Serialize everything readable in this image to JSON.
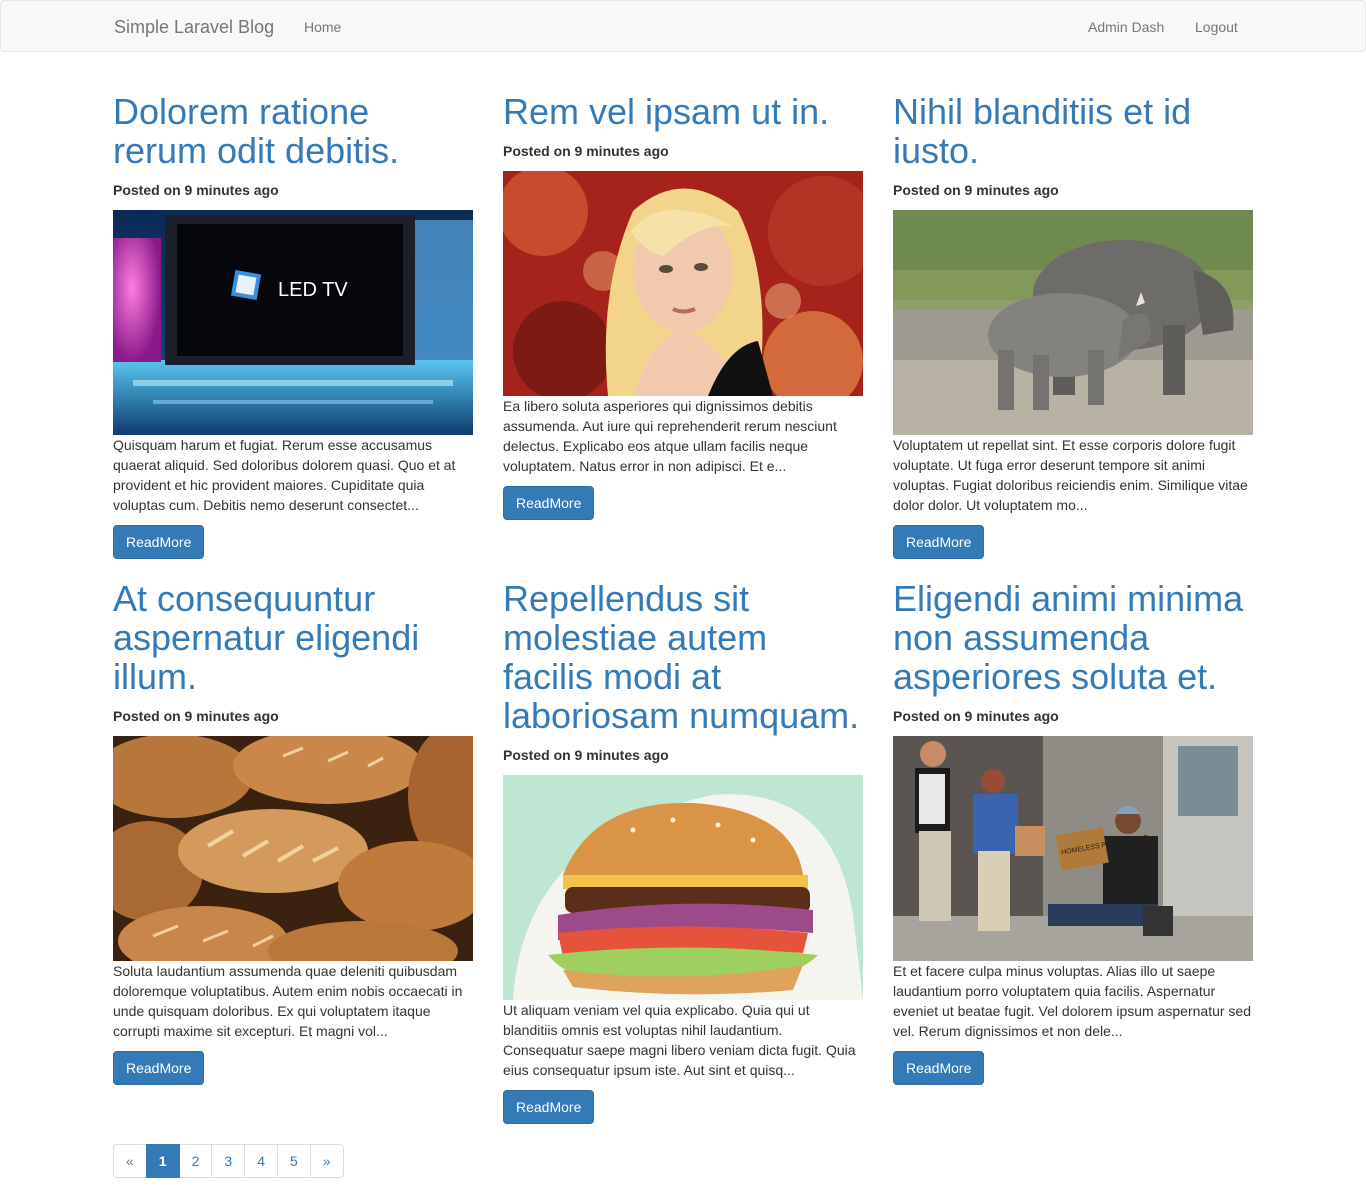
{
  "navbar": {
    "brand": "Simple Laravel Blog",
    "home": "Home",
    "admin": "Admin Dash",
    "logout": "Logout"
  },
  "posts": [
    {
      "title": "Dolorem ratione rerum odit debitis.",
      "meta": "Posted on 9 minutes ago",
      "image": "led-tv-showroom-photo",
      "excerpt": "Quisquam harum et fugiat. Rerum esse accusamus quaerat aliquid. Sed doloribus dolorem quasi. Quo et at provident et hic provident maiores. Cupiditate quia voluptas cum. Debitis nemo deserunt consectet...",
      "button": "ReadMore"
    },
    {
      "title": "Rem vel ipsam ut in.",
      "meta": "Posted on 9 minutes ago",
      "image": "blonde-woman-portrait-photo",
      "excerpt": "Ea libero soluta asperiores qui dignissimos debitis assumenda. Aut iure qui reprehenderit rerum nesciunt delectus. Explicabo eos atque ullam facilis neque voluptatem. Natus error in non adipisci. Et e...",
      "button": "ReadMore"
    },
    {
      "title": "Nihil blanditiis et id iusto.",
      "meta": "Posted on 9 minutes ago",
      "image": "rhinoceros-photo",
      "excerpt": "Voluptatem ut repellat sint. Et esse corporis dolore fugit voluptate. Ut fuga error deserunt tempore sit animi voluptas. Fugiat doloribus reiciendis enim. Similique vitae dolor dolor. Ut voluptatem mo...",
      "button": "ReadMore"
    },
    {
      "title": "At consequuntur aspernatur eligendi illum.",
      "meta": "Posted on 9 minutes ago",
      "image": "bread-loaves-photo",
      "excerpt": "Soluta laudantium assumenda quae deleniti quibusdam doloremque voluptatibus. Autem enim nobis occaecati in unde quisquam doloribus. Ex qui voluptatem itaque corrupti maxime sit excepturi. Et magni vol...",
      "button": "ReadMore"
    },
    {
      "title": "Repellendus sit molestiae autem facilis modi at laboriosam numquam.",
      "meta": "Posted on 9 minutes ago",
      "image": "hamburger-photo",
      "excerpt": "Ut aliquam veniam vel quia explicabo. Quia qui ut blanditiis omnis est voluptas nihil laudantium. Consequatur saepe magni libero veniam dicta fugit. Quia eius consequatur ipsum iste. Aut sint et quisq...",
      "button": "ReadMore"
    },
    {
      "title": "Eligendi animi minima non assumenda asperiores soluta et.",
      "meta": "Posted on 9 minutes ago",
      "image": "street-scene-photo",
      "excerpt": "Et et facere culpa minus voluptas. Alias illo ut saepe laudantium porro voluptatem quia facilis. Aspernatur eveniet ut beatae fugit. Vel dolorem ipsum aspernatur sed vel. Rerum dignissimos et non dele...",
      "button": "ReadMore"
    }
  ],
  "image_texts": {
    "tv_logo": "LED TV",
    "street_sign": "HOMELESS PLEASE HELP"
  },
  "pagination": {
    "prev": "«",
    "pages": [
      "1",
      "2",
      "3",
      "4",
      "5"
    ],
    "active": "1",
    "next": "»"
  },
  "colors": {
    "link": "#337ab7",
    "navbar_bg": "#f8f8f8",
    "text": "#333333",
    "nav_text": "#777777"
  }
}
